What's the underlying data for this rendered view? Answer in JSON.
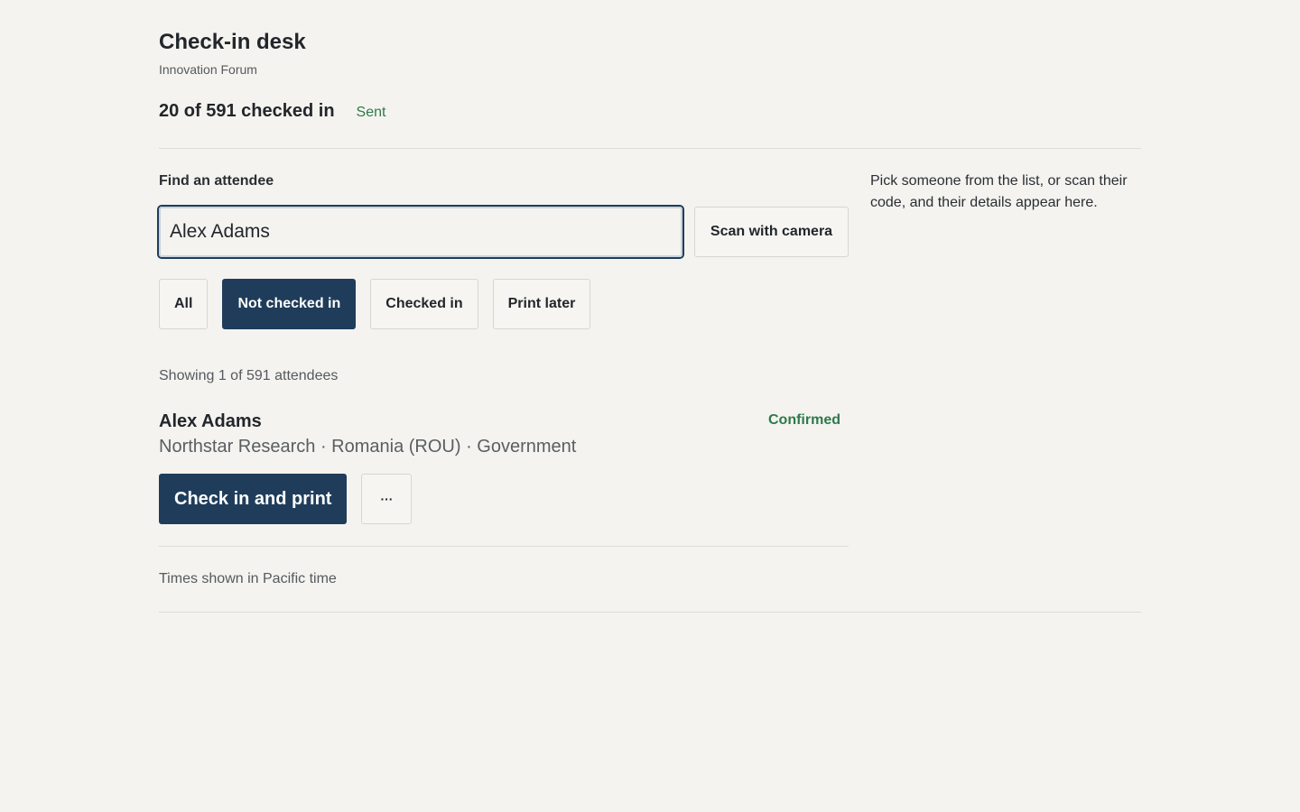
{
  "header": {
    "title": "Check-in desk",
    "event_name": "Innovation Forum"
  },
  "stats": {
    "summary": "20 of 591 checked in",
    "sync_status": "Sent"
  },
  "search": {
    "label": "Find an attendee",
    "value": "Alex Adams",
    "scan_label": "Scan with camera"
  },
  "filters": [
    {
      "label": "All",
      "active": false
    },
    {
      "label": "Not checked in",
      "active": true
    },
    {
      "label": "Checked in",
      "active": false
    },
    {
      "label": "Print later",
      "active": false
    }
  ],
  "results": {
    "count_text": "Showing 1 of 591 attendees",
    "attendees": [
      {
        "name": "Alex Adams",
        "status": "Confirmed",
        "meta": "Northstar Research · Romania (ROU) · Government",
        "primary_action": "Check in and print",
        "more_label": "···"
      }
    ]
  },
  "footnote": "Times shown in Pacific time",
  "detail_panel": {
    "hint": "Pick someone from the list, or scan their code, and their details appear here."
  },
  "colors": {
    "accent": "#1f3d5a",
    "success": "#2e7a4a",
    "background": "#f4f3ef"
  }
}
